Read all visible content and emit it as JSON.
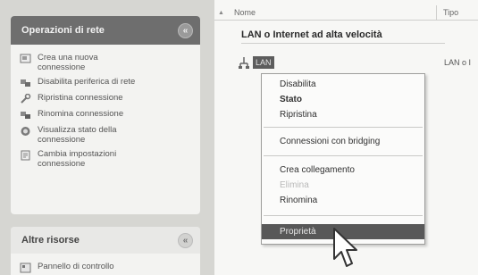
{
  "task_pane": {
    "network_tasks": {
      "title": "Operazioni di rete",
      "collapse_glyph": "«",
      "items": [
        {
          "icon": "new-connection-icon",
          "label": "Crea una nuova\nconnessione"
        },
        {
          "icon": "disable-device-icon",
          "label": "Disabilita periferica di rete"
        },
        {
          "icon": "repair-icon",
          "label": "Ripristina connessione"
        },
        {
          "icon": "rename-icon",
          "label": "Rinomina connessione"
        },
        {
          "icon": "status-icon",
          "label": "Visualizza stato della\nconnessione"
        },
        {
          "icon": "settings-icon",
          "label": "Cambia impostazioni\nconnessione"
        }
      ]
    },
    "other_places": {
      "title": "Altre risorse",
      "collapse_glyph": "«",
      "items": [
        {
          "icon": "control-panel-icon",
          "label": "Pannello di controllo"
        }
      ]
    }
  },
  "list_view": {
    "columns": {
      "name": "Nome",
      "type": "Tipo"
    },
    "group_header": "LAN o Internet ad alta velocità",
    "item": {
      "name": "LAN",
      "type": "LAN o I"
    }
  },
  "context_menu": {
    "items": [
      {
        "label": "Disabilita",
        "bold": false,
        "disabled": false
      },
      {
        "label": "Stato",
        "bold": true,
        "disabled": false
      },
      {
        "label": "Ripristina",
        "bold": false,
        "disabled": false
      },
      {
        "label": "Connessioni con bridging",
        "bold": false,
        "disabled": false
      },
      {
        "label": "Crea collegamento",
        "bold": false,
        "disabled": false
      },
      {
        "label": "Elimina",
        "bold": false,
        "disabled": true
      },
      {
        "label": "Rinomina",
        "bold": false,
        "disabled": false
      },
      {
        "label": "Proprietà",
        "bold": false,
        "disabled": false,
        "selected": true
      }
    ]
  },
  "colors": {
    "panel_header": "#6e6e6e",
    "selection": "#585858",
    "pane_background": "#d6d6d2"
  }
}
